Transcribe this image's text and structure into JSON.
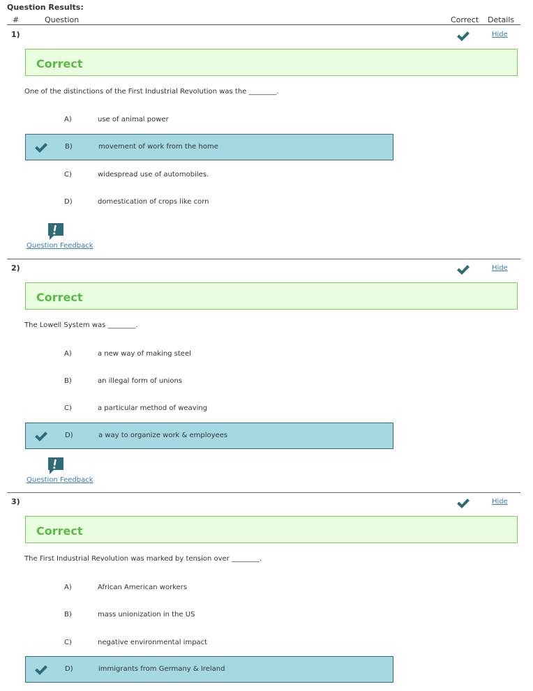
{
  "results": {
    "title": "Question Results:",
    "columns": {
      "number": "#",
      "question": "Question",
      "correct": "Correct",
      "details": "Details"
    }
  },
  "colors": {
    "accent": "#2f6b78",
    "banner_bg": "#eaffdf",
    "banner_border": "#7acd5a",
    "selected_bg": "#a6d8e2",
    "link": "#3a7fa8"
  },
  "questions": [
    {
      "number": "1)",
      "status": "Correct",
      "hide_label": "Hide",
      "text": "One of the distinctions of the First Industrial Revolution was the ________.",
      "options": [
        {
          "letter": "A)",
          "text": "use of animal power",
          "selected": false
        },
        {
          "letter": "B)",
          "text": "movement of work from the home",
          "selected": true
        },
        {
          "letter": "C)",
          "text": "widespread use of automobiles.",
          "selected": false
        },
        {
          "letter": "D)",
          "text": "domestication of crops like corn",
          "selected": false
        }
      ],
      "feedback_label": "Question Feedback"
    },
    {
      "number": "2)",
      "status": "Correct",
      "hide_label": "Hide",
      "text": "The Lowell System was ________.",
      "options": [
        {
          "letter": "A)",
          "text": "a new way of making steel",
          "selected": false
        },
        {
          "letter": "B)",
          "text": "an illegal form of unions",
          "selected": false
        },
        {
          "letter": "C)",
          "text": "a particular method of weaving",
          "selected": false
        },
        {
          "letter": "D)",
          "text": "a way to organize work & employees",
          "selected": true
        }
      ],
      "feedback_label": "Question Feedback"
    },
    {
      "number": "3)",
      "status": "Correct",
      "hide_label": "Hide",
      "text": "The First Industrial Revolution was marked by tension over ________.",
      "options": [
        {
          "letter": "A)",
          "text": "African American workers",
          "selected": false
        },
        {
          "letter": "B)",
          "text": "mass unionization in the US",
          "selected": false
        },
        {
          "letter": "C)",
          "text": "negative environmental impact",
          "selected": false
        },
        {
          "letter": "D)",
          "text": "immigrants from Germany & Ireland",
          "selected": true
        }
      ]
    }
  ]
}
